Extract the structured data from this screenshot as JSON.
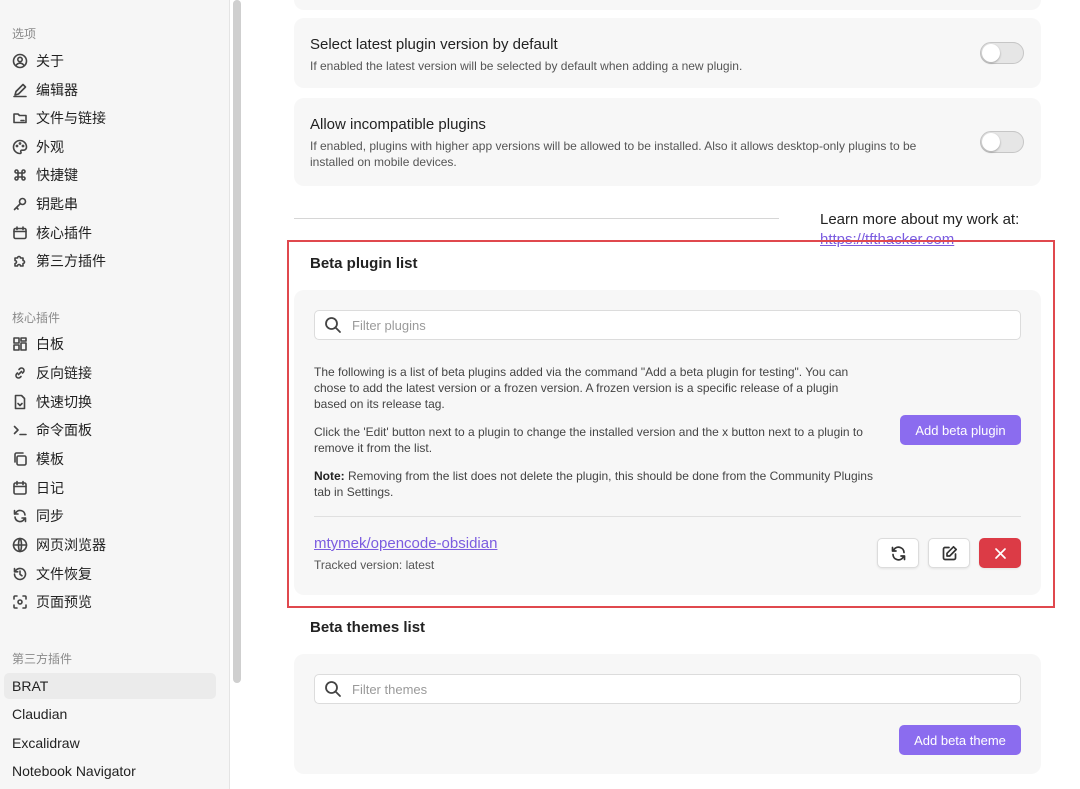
{
  "sidebar": {
    "groups": {
      "options": "选项",
      "core_plugins": "核心插件",
      "third_party": "第三方插件"
    },
    "options_items": [
      {
        "label": "关于",
        "icon": "user-circle-icon"
      },
      {
        "label": "编辑器",
        "icon": "pencil-icon"
      },
      {
        "label": "文件与链接",
        "icon": "folder-link-icon"
      },
      {
        "label": "外观",
        "icon": "palette-icon"
      },
      {
        "label": "快捷键",
        "icon": "command-icon"
      },
      {
        "label": "钥匙串",
        "icon": "key-icon"
      },
      {
        "label": "核心插件",
        "icon": "calendar-plugin-icon"
      },
      {
        "label": "第三方插件",
        "icon": "puzzle-icon"
      }
    ],
    "core_items": [
      {
        "label": "白板",
        "icon": "layout-grid-icon"
      },
      {
        "label": "反向链接",
        "icon": "backlink-icon"
      },
      {
        "label": "快速切换",
        "icon": "file-switch-icon"
      },
      {
        "label": "命令面板",
        "icon": "terminal-icon"
      },
      {
        "label": "模板",
        "icon": "copy-icon"
      },
      {
        "label": "日记",
        "icon": "calendar-icon"
      },
      {
        "label": "同步",
        "icon": "sync-icon"
      },
      {
        "label": "网页浏览器",
        "icon": "globe-icon"
      },
      {
        "label": "文件恢复",
        "icon": "history-icon"
      },
      {
        "label": "页面预览",
        "icon": "scan-eye-icon"
      }
    ],
    "third_items": [
      {
        "label": "BRAT",
        "active": true
      },
      {
        "label": "Claudian",
        "active": false
      },
      {
        "label": "Excalidraw",
        "active": false
      },
      {
        "label": "Notebook Navigator",
        "active": false
      }
    ]
  },
  "settings": {
    "latest_version": {
      "title": "Select latest plugin version by default",
      "desc": "If enabled the latest version will be selected by default when adding a new plugin.",
      "enabled": false
    },
    "incompatible": {
      "title": "Allow incompatible plugins",
      "desc": "If enabled, plugins with higher app versions will be allowed to be installed. Also it allows desktop-only plugins to be installed on mobile devices.",
      "enabled": false
    }
  },
  "promo": {
    "text": "Learn more about my work at:",
    "link": "https://tfthacker.com"
  },
  "beta_plugins": {
    "heading": "Beta plugin list",
    "filter_placeholder": "Filter plugins",
    "para1": "The following is a list of beta plugins added via the command \"Add a beta plugin for testing\". You can chose to add the latest version or a frozen version. A frozen version is a specific release of a plugin based on its release tag.",
    "para2": "Click the 'Edit' button next to a plugin to change the installed version and the x button next to a plugin to remove it from the list.",
    "note_label": "Note:",
    "note_text": " Removing from the list does not delete the plugin, this should be done from the Community Plugins tab in Settings.",
    "add_button": "Add beta plugin",
    "items": [
      {
        "name": "mtymek/opencode-obsidian",
        "tracked": "Tracked version: latest"
      }
    ]
  },
  "beta_themes": {
    "heading": "Beta themes list",
    "filter_placeholder": "Filter themes",
    "add_button": "Add beta theme"
  },
  "colors": {
    "accent": "#8b6cef",
    "link": "#7b5ce0",
    "danger": "#dc3b46",
    "highlight_border": "#e0484e"
  }
}
